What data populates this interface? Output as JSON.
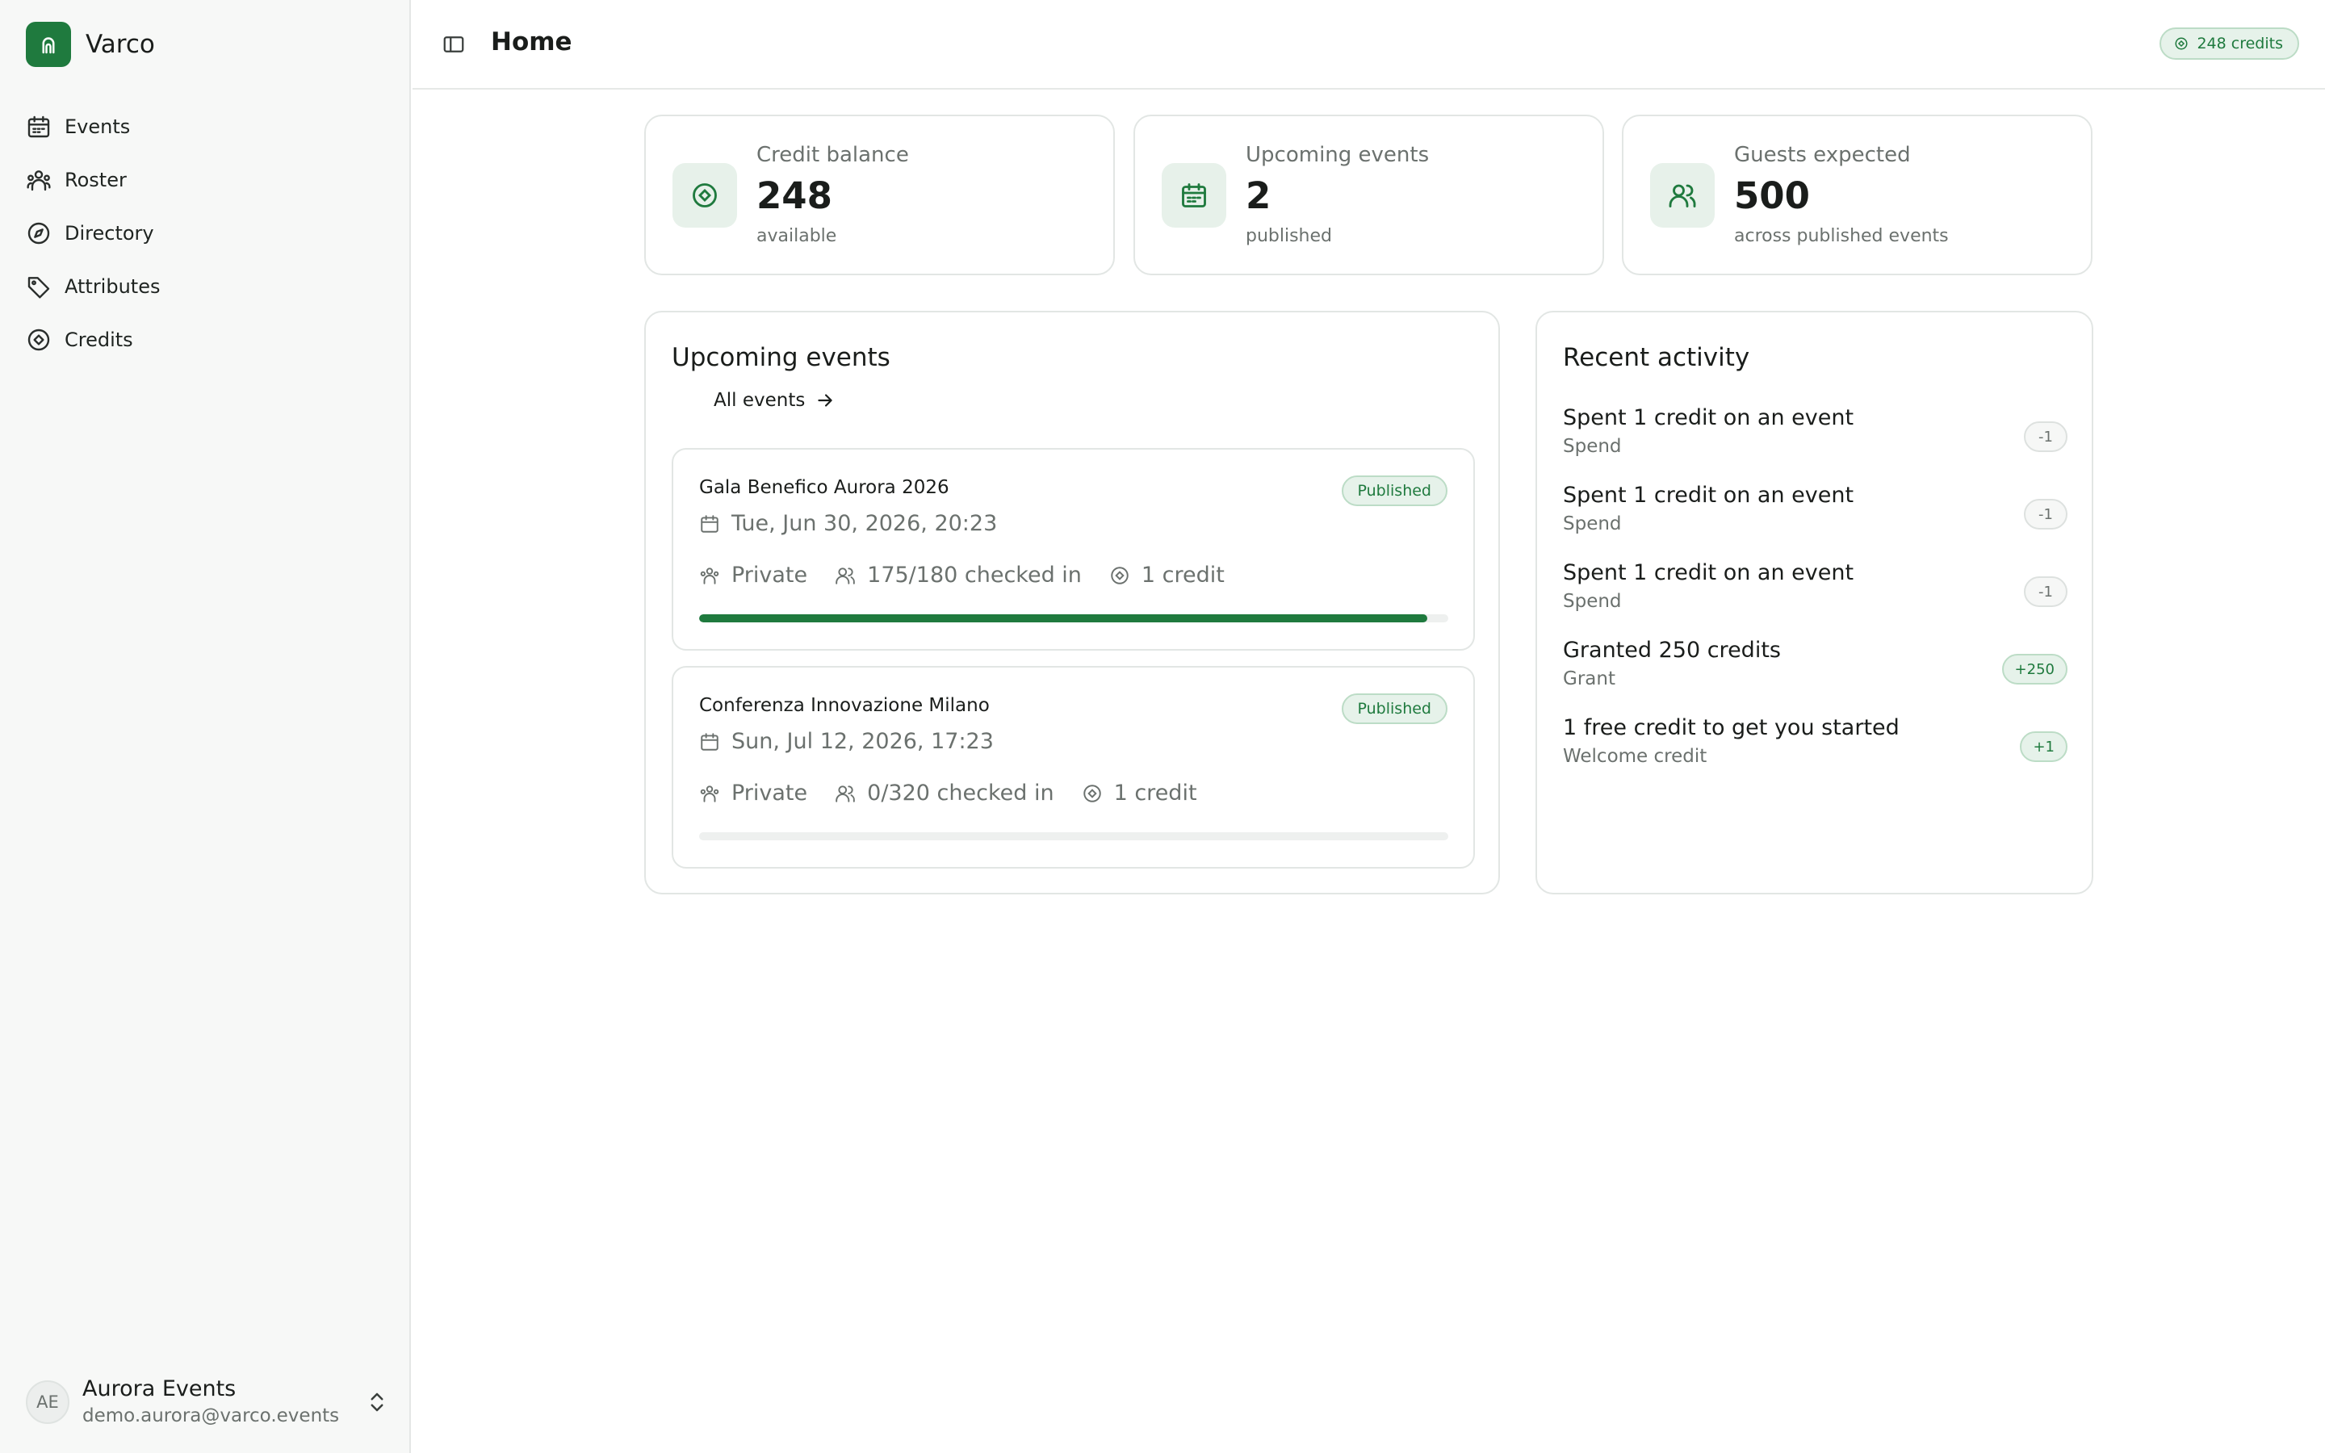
{
  "brand": {
    "name": "Varco",
    "accent": "#1f7a3e"
  },
  "sidebar": {
    "items": [
      {
        "label": "Events",
        "icon": "calendar-icon"
      },
      {
        "label": "Roster",
        "icon": "people-icon"
      },
      {
        "label": "Directory",
        "icon": "compass-icon"
      },
      {
        "label": "Attributes",
        "icon": "tag-icon"
      },
      {
        "label": "Credits",
        "icon": "credit-icon"
      }
    ],
    "account": {
      "initials": "AE",
      "name": "Aurora Events",
      "email": "demo.aurora@varco.events"
    }
  },
  "header": {
    "title": "Home",
    "credits_pill": "248 credits"
  },
  "stats": [
    {
      "label": "Credit balance",
      "value": "248",
      "sub": "available",
      "icon": "credit-icon"
    },
    {
      "label": "Upcoming events",
      "value": "2",
      "sub": "published",
      "icon": "calendar-icon"
    },
    {
      "label": "Guests expected",
      "value": "500",
      "sub": "across published events",
      "icon": "users-icon"
    }
  ],
  "upcoming": {
    "title": "Upcoming events",
    "all_link": "All events",
    "events": [
      {
        "name": "Gala Benefico Aurora 2026",
        "status": "Published",
        "date": "Tue, Jun 30, 2026, 20:23",
        "visibility": "Private",
        "checkin": "175/180 checked in",
        "cost": "1 credit",
        "progress": 0.972
      },
      {
        "name": "Conferenza Innovazione Milano",
        "status": "Published",
        "date": "Sun, Jul 12, 2026, 17:23",
        "visibility": "Private",
        "checkin": "0/320 checked in",
        "cost": "1 credit",
        "progress": 0
      }
    ]
  },
  "activity": {
    "title": "Recent activity",
    "items": [
      {
        "title": "Spent 1 credit on an event",
        "sub": "Spend",
        "amount": "-1",
        "kind": "neg"
      },
      {
        "title": "Spent 1 credit on an event",
        "sub": "Spend",
        "amount": "-1",
        "kind": "neg"
      },
      {
        "title": "Spent 1 credit on an event",
        "sub": "Spend",
        "amount": "-1",
        "kind": "neg"
      },
      {
        "title": "Granted 250 credits",
        "sub": "Grant",
        "amount": "+250",
        "kind": "pos"
      },
      {
        "title": "1 free credit to get you started",
        "sub": "Welcome credit",
        "amount": "+1",
        "kind": "pos"
      }
    ]
  }
}
